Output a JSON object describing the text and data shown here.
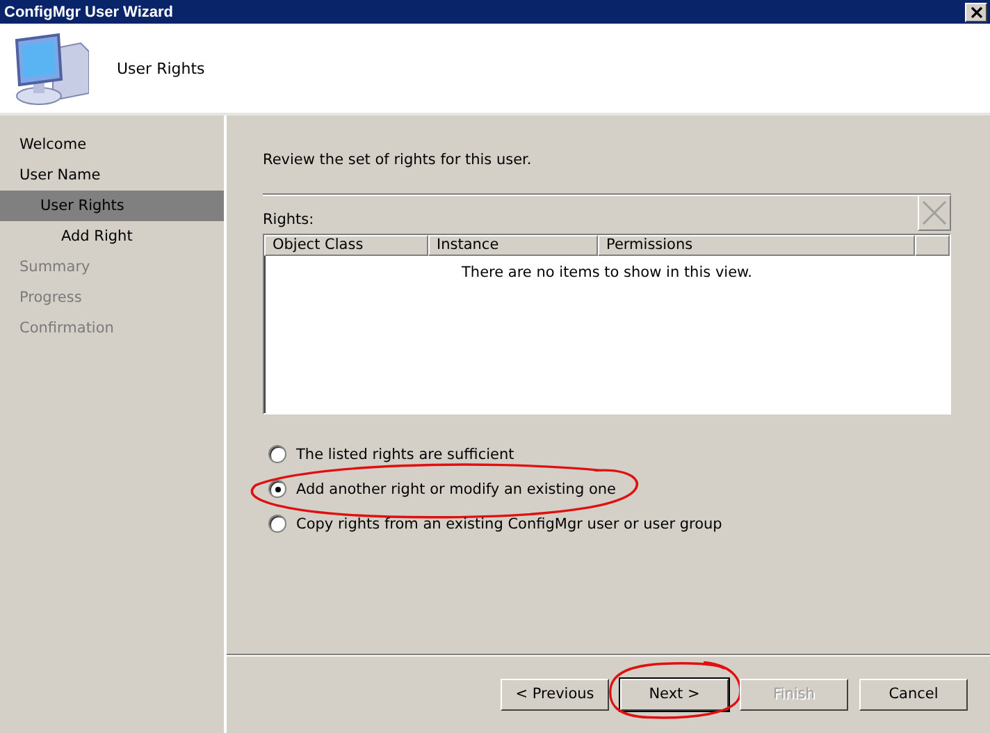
{
  "window": {
    "title": "ConfigMgr User Wizard"
  },
  "header": {
    "title": "User Rights"
  },
  "sidebar": {
    "items": [
      {
        "label": "Welcome",
        "selected": false,
        "disabled": false
      },
      {
        "label": "User Name",
        "selected": false,
        "disabled": false,
        "children": [
          {
            "label": "User Rights",
            "selected": true,
            "disabled": false,
            "children": [
              {
                "label": "Add Right",
                "selected": false,
                "disabled": false
              }
            ]
          }
        ]
      },
      {
        "label": "Summary",
        "selected": false,
        "disabled": true
      },
      {
        "label": "Progress",
        "selected": false,
        "disabled": true
      },
      {
        "label": "Confirmation",
        "selected": false,
        "disabled": true
      }
    ]
  },
  "intro": "Review the set of rights for this user.",
  "rights": {
    "label": "Rights:",
    "columns": [
      "Object Class",
      "Instance",
      "Permissions"
    ],
    "empty_text": "There are no items to show in this view.",
    "remove_disabled": true
  },
  "options": [
    {
      "label": "The listed rights are sufficient",
      "selected": false
    },
    {
      "label": "Add another right or modify an existing one",
      "selected": true,
      "annotation": {
        "kind": "ellipse"
      }
    },
    {
      "label": "Copy rights from an existing ConfigMgr user or user group",
      "selected": false
    }
  ],
  "buttons": [
    {
      "label": "< Previous",
      "disabled": false,
      "default": false
    },
    {
      "label": "Next >",
      "disabled": false,
      "default": true,
      "annotation": {
        "kind": "ellipse"
      }
    },
    {
      "label": "Finish",
      "disabled": true,
      "default": false
    },
    {
      "label": "Cancel",
      "disabled": false,
      "default": false
    }
  ]
}
